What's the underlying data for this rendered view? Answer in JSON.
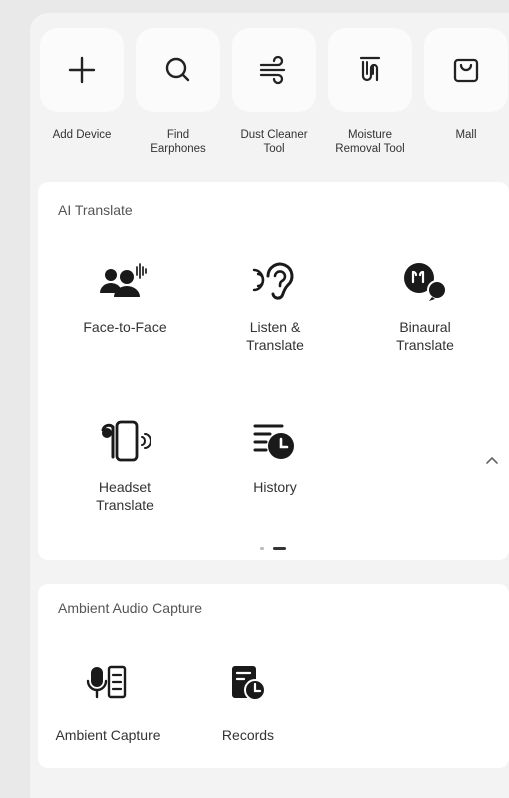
{
  "tools": [
    {
      "label_1": "Add Device",
      "label_2": "",
      "icon": "plus-icon"
    },
    {
      "label_1": "Find",
      "label_2": "Earphones",
      "icon": "search-icon"
    },
    {
      "label_1": "Dust Cleaner",
      "label_2": "Tool",
      "icon": "wind-icon"
    },
    {
      "label_1": "Moisture",
      "label_2": "Removal Tool",
      "icon": "moisture-icon"
    },
    {
      "label_1": "Mall",
      "label_2": "",
      "icon": "shopping-bag-icon"
    }
  ],
  "ai_translate": {
    "title": "AI Translate",
    "items": [
      {
        "label_1": "Face-to-Face",
        "label_2": "",
        "icon": "face-to-face-icon"
      },
      {
        "label_1": "Listen &",
        "label_2": "Translate",
        "icon": "listen-ear-icon"
      },
      {
        "label_1": "Binaural",
        "label_2": "Translate",
        "icon": "binaural-earbuds-icon"
      },
      {
        "label_1": "Headset",
        "label_2": "Translate",
        "icon": "headset-phone-icon"
      },
      {
        "label_1": "History",
        "label_2": "",
        "icon": "history-clock-icon"
      }
    ],
    "collapse_icon": "chevron-up-icon"
  },
  "ambient": {
    "title": "Ambient Audio Capture",
    "items": [
      {
        "label_1": "Ambient Capture",
        "icon": "mic-list-icon"
      },
      {
        "label_1": "Records",
        "icon": "records-clock-icon"
      }
    ]
  }
}
